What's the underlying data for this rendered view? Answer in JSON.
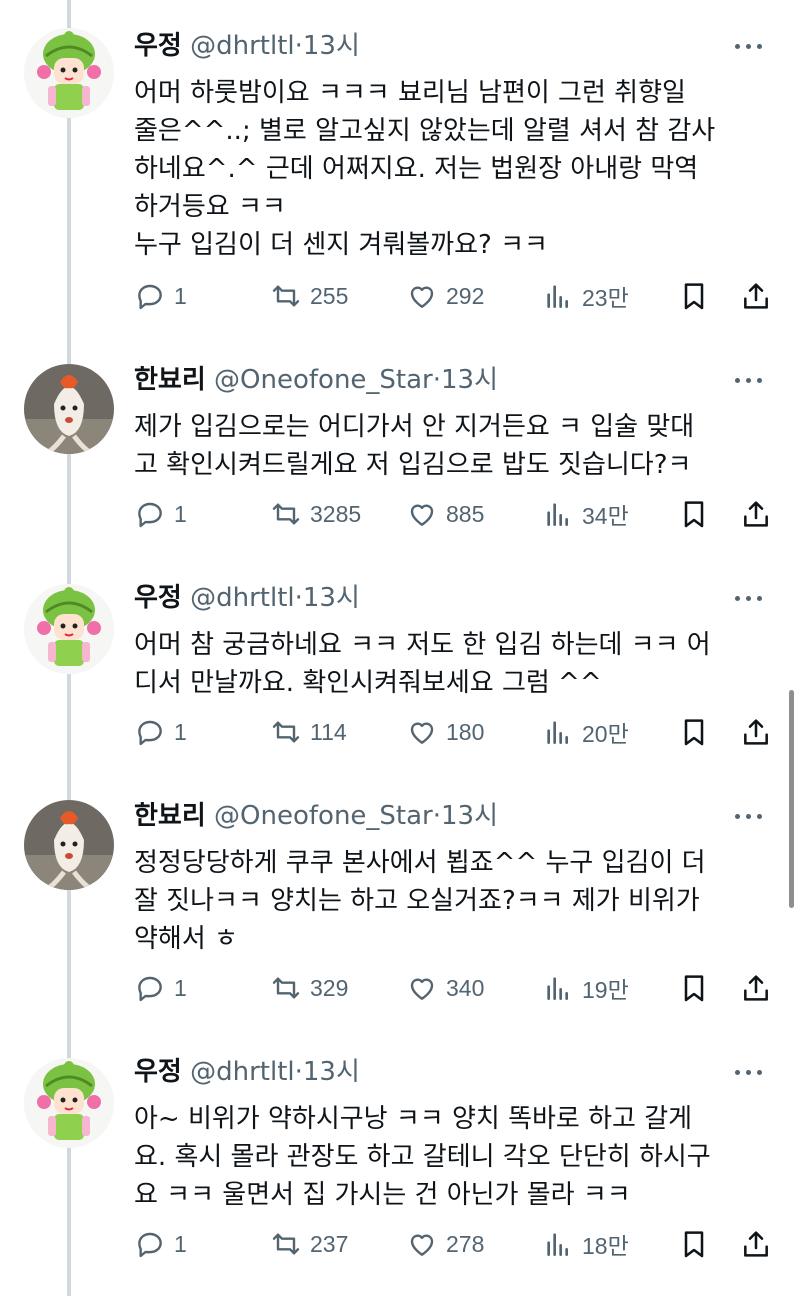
{
  "tweets": [
    {
      "name": "우정",
      "handle": "@dhrtltl",
      "sep": "·",
      "time": "13시",
      "avatar": "knit-hat-girl",
      "text": "어머 하룻밤이요 ㅋㅋㅋ 뵤리님 남편이 그런 취향일\n줄은^^..; 별로 알고싶지 않았는데 알렬 셔서 참 감사\n하네요^.^ 근데 어쩌지요. 저는 법원장 아내랑 막역\n하거등요 ㅋㅋ\n누구 입김이 더 센지 겨뤄볼까요? ㅋㅋ",
      "replies": "1",
      "retweets": "255",
      "likes": "292",
      "views": "23만"
    },
    {
      "name": "한뵤리",
      "handle": "@Oneofone_Star",
      "sep": "·",
      "time": "13시",
      "avatar": "goldfish",
      "text": "제가 입김으로는 어디가서 안 지거든요 ㅋ 입술 맞대\n고 확인시켜드릴게요 저 입김으로 밥도 짓습니다?ㅋ",
      "replies": "1",
      "retweets": "3285",
      "likes": "885",
      "views": "34만"
    },
    {
      "name": "우정",
      "handle": "@dhrtltl",
      "sep": "·",
      "time": "13시",
      "avatar": "knit-hat-girl",
      "text": "어머 참 궁금하네요 ㅋㅋ 저도 한 입김 하는데 ㅋㅋ 어\n디서 만날까요. 확인시켜줘보세요 그럼 ^^",
      "replies": "1",
      "retweets": "114",
      "likes": "180",
      "views": "20만"
    },
    {
      "name": "한뵤리",
      "handle": "@Oneofone_Star",
      "sep": "·",
      "time": "13시",
      "avatar": "goldfish",
      "text": "정정당당하게 쿠쿠 본사에서 뵙죠^^ 누구 입김이 더\n잘 짓나ㅋㅋ 양치는 하고 오실거죠?ㅋㅋ 제가 비위가\n약해서 ㅎ",
      "replies": "1",
      "retweets": "329",
      "likes": "340",
      "views": "19만"
    },
    {
      "name": "우정",
      "handle": "@dhrtltl",
      "sep": "·",
      "time": "13시",
      "avatar": "knit-hat-girl",
      "text": "아~ 비위가 약하시구낭 ㅋㅋ 양치 똑바로 하고 갈게\n요. 혹시 몰라 관장도 하고 갈테니 각오 단단히 하시구\n요 ㅋㅋ 울면서 집 가시는 건 아닌가 몰라 ㅋㅋ",
      "replies": "1",
      "retweets": "237",
      "likes": "278",
      "views": "18만"
    }
  ],
  "colors": {
    "text": "#0f1419",
    "muted": "#536471",
    "thread_line": "#cfd9de",
    "background": "#ffffff"
  },
  "icons": [
    "reply-icon",
    "retweet-icon",
    "like-icon",
    "views-icon",
    "bookmark-icon",
    "share-icon",
    "more-icon"
  ]
}
